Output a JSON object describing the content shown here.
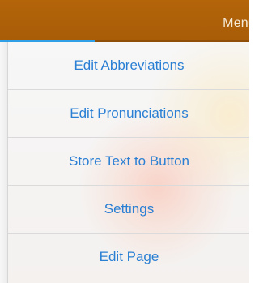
{
  "header": {
    "title": "Menu",
    "progress": 0.38
  },
  "menu": {
    "items": [
      {
        "label": "Edit Abbreviations"
      },
      {
        "label": "Edit Pronunciations"
      },
      {
        "label": "Store Text to Button"
      },
      {
        "label": "Settings"
      },
      {
        "label": "Edit Page"
      }
    ]
  },
  "colors": {
    "header_bg": "#b4650a",
    "menu_text": "#2a7fd4",
    "progress": "#2f9fe8"
  }
}
